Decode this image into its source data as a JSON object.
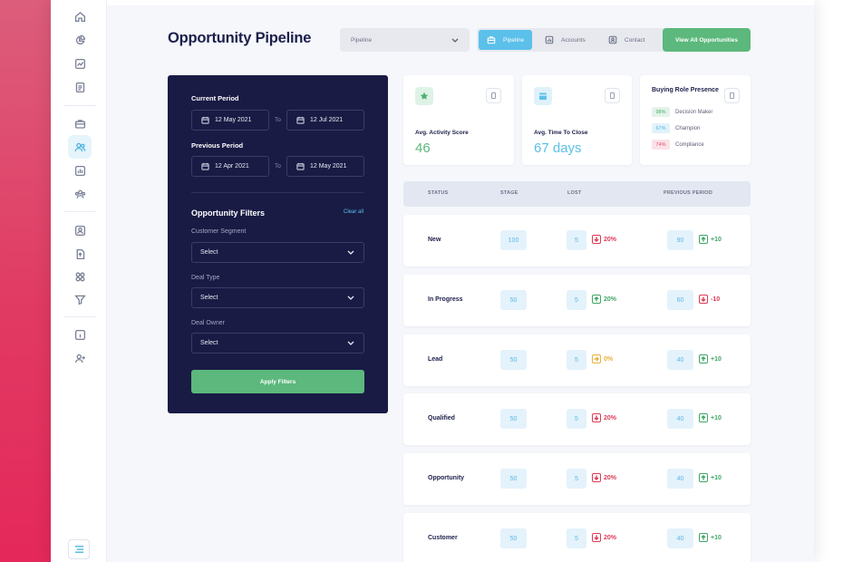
{
  "header": {
    "title": "Opportunity Pipeline",
    "select_value": "Pipeline",
    "tabs": [
      {
        "label": "Pipeline",
        "icon": "briefcase-icon",
        "active": true
      },
      {
        "label": "Accounts",
        "icon": "bar-chart-icon",
        "active": false
      },
      {
        "label": "Contact",
        "icon": "contact-card-icon",
        "active": false
      }
    ],
    "view_all_label": "View All Opportunities"
  },
  "filters": {
    "current_period_label": "Current Period",
    "current_from": "12 May 2021",
    "current_to": "12 Jul 2021",
    "previous_period_label": "Previous Period",
    "previous_from": "12 Apr 2021",
    "previous_to": "12 May 2021",
    "to_label": "To",
    "title": "Opportunity Filters",
    "clear_label": "Clear all",
    "fields": [
      {
        "label": "Customer Segment",
        "value": "Select"
      },
      {
        "label": "Deal Type",
        "value": "Select"
      },
      {
        "label": "Deal Owner",
        "value": "Select"
      }
    ],
    "apply_label": "Apply Filters"
  },
  "cards": {
    "activity": {
      "label": "Avg. Activity Score",
      "value": "46",
      "color": "#5cb87c"
    },
    "time_to_close": {
      "label": "Avg. Time To Close",
      "value": "67 days",
      "color": "#5bc0ea"
    },
    "buying_role": {
      "title": "Buying Role Presence",
      "items": [
        {
          "percent": "98%",
          "label": "Decision Maker",
          "color": "#4cae6e",
          "bg": "#e3f3e8"
        },
        {
          "percent": "67%",
          "label": "Champion",
          "color": "#4db3e0",
          "bg": "#e2f2fb"
        },
        {
          "percent": "74%",
          "label": "Compliance",
          "color": "#e04b6a",
          "bg": "#fbe2e7"
        }
      ]
    }
  },
  "table": {
    "headers": [
      "STATUS",
      "STAGE",
      "LOST",
      "PREVIOUS PERIOD"
    ],
    "rows": [
      {
        "status": "New",
        "stage": "100",
        "lost": "5",
        "lost_change": "20%",
        "lost_dir": "down",
        "prev": "90",
        "prev_change": "+10",
        "prev_dir": "up"
      },
      {
        "status": "In Progress",
        "stage": "50",
        "lost": "5",
        "lost_change": "20%",
        "lost_dir": "up",
        "prev": "60",
        "prev_change": "-10",
        "prev_dir": "down"
      },
      {
        "status": "Lead",
        "stage": "50",
        "lost": "5",
        "lost_change": "0%",
        "lost_dir": "neutral",
        "prev": "40",
        "prev_change": "+10",
        "prev_dir": "up"
      },
      {
        "status": "Qualified",
        "stage": "50",
        "lost": "5",
        "lost_change": "20%",
        "lost_dir": "down",
        "prev": "40",
        "prev_change": "+10",
        "prev_dir": "up"
      },
      {
        "status": "Opportunity",
        "stage": "50",
        "lost": "5",
        "lost_change": "20%",
        "lost_dir": "down",
        "prev": "40",
        "prev_change": "+10",
        "prev_dir": "up"
      },
      {
        "status": "Customer",
        "stage": "50",
        "lost": "5",
        "lost_change": "20%",
        "lost_dir": "down",
        "prev": "40",
        "prev_change": "+10",
        "prev_dir": "up"
      }
    ]
  },
  "colors": {
    "up": "#3fa565",
    "down": "#dc3a55",
    "neutral": "#e8b13a"
  }
}
